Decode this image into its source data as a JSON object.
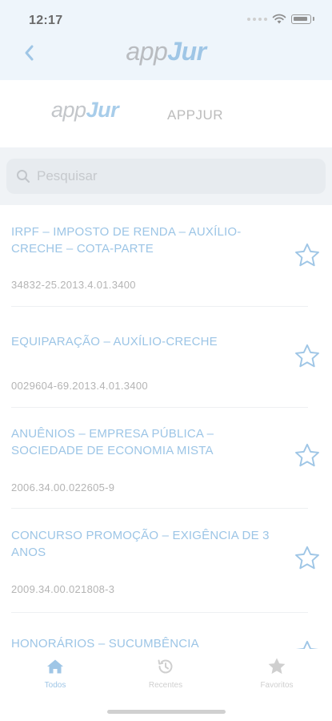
{
  "status_bar": {
    "time": "12:17"
  },
  "nav": {
    "brand_part1": "app",
    "brand_part2": "Jur"
  },
  "sub_header": {
    "logo_part1": "app",
    "logo_part2": "Jur",
    "app_name": "APPJUR"
  },
  "search": {
    "placeholder": "Pesquisar"
  },
  "list": {
    "items": [
      {
        "title": "IRPF – IMPOSTO DE RENDA – AUXÍLIO-CRECHE – COTA-PARTE",
        "number": "34832-25.2013.4.01.3400"
      },
      {
        "title": "EQUIPARAÇÃO – AUXÍLIO-CRECHE",
        "number": "0029604-69.2013.4.01.3400"
      },
      {
        "title": "ANUÊNIOS – EMPRESA PÚBLICA – SOCIEDADE DE ECONOMIA MISTA",
        "number": "2006.34.00.022605-9"
      },
      {
        "title": "CONCURSO PROMOÇÃO – EXIGÊNCIA DE 3 ANOS",
        "number": "2009.34.00.021808-3"
      },
      {
        "title": "HONORÁRIOS – SUCUMBÊNCIA",
        "number": ""
      }
    ]
  },
  "tabs": [
    {
      "label": "Todos",
      "icon": "home-icon",
      "active": true
    },
    {
      "label": "Recentes",
      "icon": "clock-icon",
      "active": false
    },
    {
      "label": "Favoritos",
      "icon": "star-filled-icon",
      "active": false
    }
  ],
  "colors": {
    "accent": "#9fc6e6",
    "header_bg": "#eef5fb",
    "muted": "#b4b4b4"
  }
}
